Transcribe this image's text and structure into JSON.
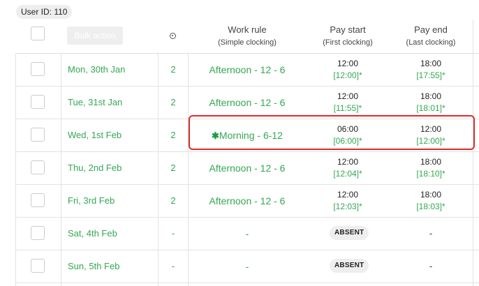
{
  "user_badge": "User ID: 110",
  "header": {
    "bulk_action": "Bulk action",
    "work_rule": "Work rule",
    "work_rule_sub": "(Simple clocking)",
    "pay_start": "Pay start",
    "pay_start_sub": "(First clocking)",
    "pay_end": "Pay end",
    "pay_end_sub": "(Last clocking)"
  },
  "rows": [
    {
      "date": "Mon, 30th Jan",
      "count": "2",
      "rule": "Afternoon - 12 - 6",
      "start": "12:00",
      "start_actual": "[12:00]*",
      "end": "18:00",
      "end_actual": "[17:55]*"
    },
    {
      "date": "Tue, 31st Jan",
      "count": "2",
      "rule": "Afternoon - 12 - 6",
      "start": "12:00",
      "start_actual": "[11:55]*",
      "end": "18:00",
      "end_actual": "[18:01]*"
    },
    {
      "date": "Wed, 1st Feb",
      "count": "2",
      "rule_marker": "✱",
      "rule": "Morning - 6-12",
      "start": "06:00",
      "start_actual": "[06:00]*",
      "end": "12:00",
      "end_actual": "[12:00]*"
    },
    {
      "date": "Thu, 2nd Feb",
      "count": "2",
      "rule": "Afternoon - 12 - 6",
      "start": "12:00",
      "start_actual": "[12:04]*",
      "end": "18:00",
      "end_actual": "[18:10]*"
    },
    {
      "date": "Fri, 3rd Feb",
      "count": "2",
      "rule": "Afternoon - 12 - 6",
      "start": "12:00",
      "start_actual": "[12:03]*",
      "end": "18:00",
      "end_actual": "[18:03]*"
    },
    {
      "date": "Sat, 4th Feb",
      "count": "-",
      "rule": "-",
      "status": "ABSENT",
      "end": "-"
    },
    {
      "date": "Sun, 5th Feb",
      "count": "-",
      "rule": "-",
      "status": "ABSENT",
      "end": "-"
    }
  ],
  "icons": {
    "clocking_count_header": "clock-icon",
    "modified_rule_marker": "asterisk-icon"
  },
  "colors": {
    "accent_green": "#33a853",
    "highlight_red": "#e02a2a",
    "badge_gray": "#eeeeee"
  }
}
